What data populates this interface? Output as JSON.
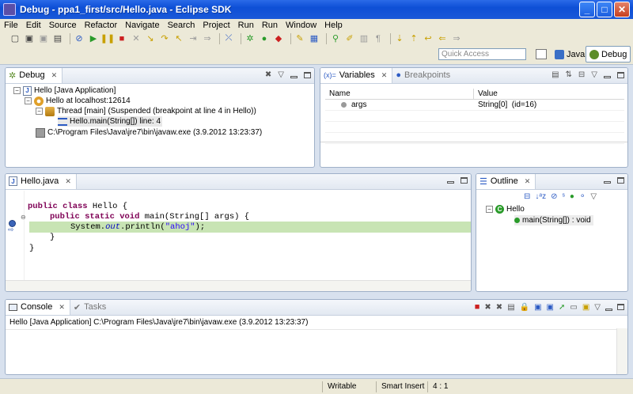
{
  "window": {
    "title": "Debug - ppa1_first/src/Hello.java - Eclipse SDK"
  },
  "menu": [
    "File",
    "Edit",
    "Source",
    "Refactor",
    "Navigate",
    "Search",
    "Project",
    "Run",
    "Run",
    "Window",
    "Help"
  ],
  "quick_access": {
    "placeholder": "Quick Access"
  },
  "perspectives": [
    {
      "label": "Java",
      "active": false
    },
    {
      "label": "Debug",
      "active": true
    }
  ],
  "debug_view": {
    "tab": "Debug",
    "tree": [
      "Hello [Java Application]",
      "Hello at localhost:12614",
      "Thread [main] (Suspended (breakpoint at line 4 in Hello))",
      "Hello.main(String[]) line: 4",
      "C:\\Program Files\\Java\\jre7\\bin\\javaw.exe (3.9.2012 13:23:37)"
    ]
  },
  "variables_view": {
    "tabs": [
      "Variables",
      "Breakpoints"
    ],
    "columns": [
      "Name",
      "Value"
    ],
    "rows": [
      {
        "name": "args",
        "value": "String[0]  (id=16)"
      }
    ]
  },
  "editor": {
    "tab": "Hello.java",
    "lines": {
      "l1_kw": "public class",
      "l1_rest": " Hello {",
      "l2_kw": "public static void",
      "l2_rest": " main(String[] args) {",
      "l3_pre": "System.",
      "l3_out": "out",
      "l3_mid": ".println(",
      "l3_str": "\"ahoj\"",
      "l3_end": ");",
      "l4": "}",
      "l5": "}"
    }
  },
  "outline_view": {
    "tab": "Outline",
    "class_name": "Hello",
    "method": "main(String[]) : void"
  },
  "console_view": {
    "tabs": [
      "Console",
      "Tasks"
    ],
    "header": "Hello [Java Application] C:\\Program Files\\Java\\jre7\\bin\\javaw.exe (3.9.2012 13:23:37)"
  },
  "status": {
    "writable": "Writable",
    "insert_mode": "Smart Insert",
    "position": "4 : 1"
  }
}
